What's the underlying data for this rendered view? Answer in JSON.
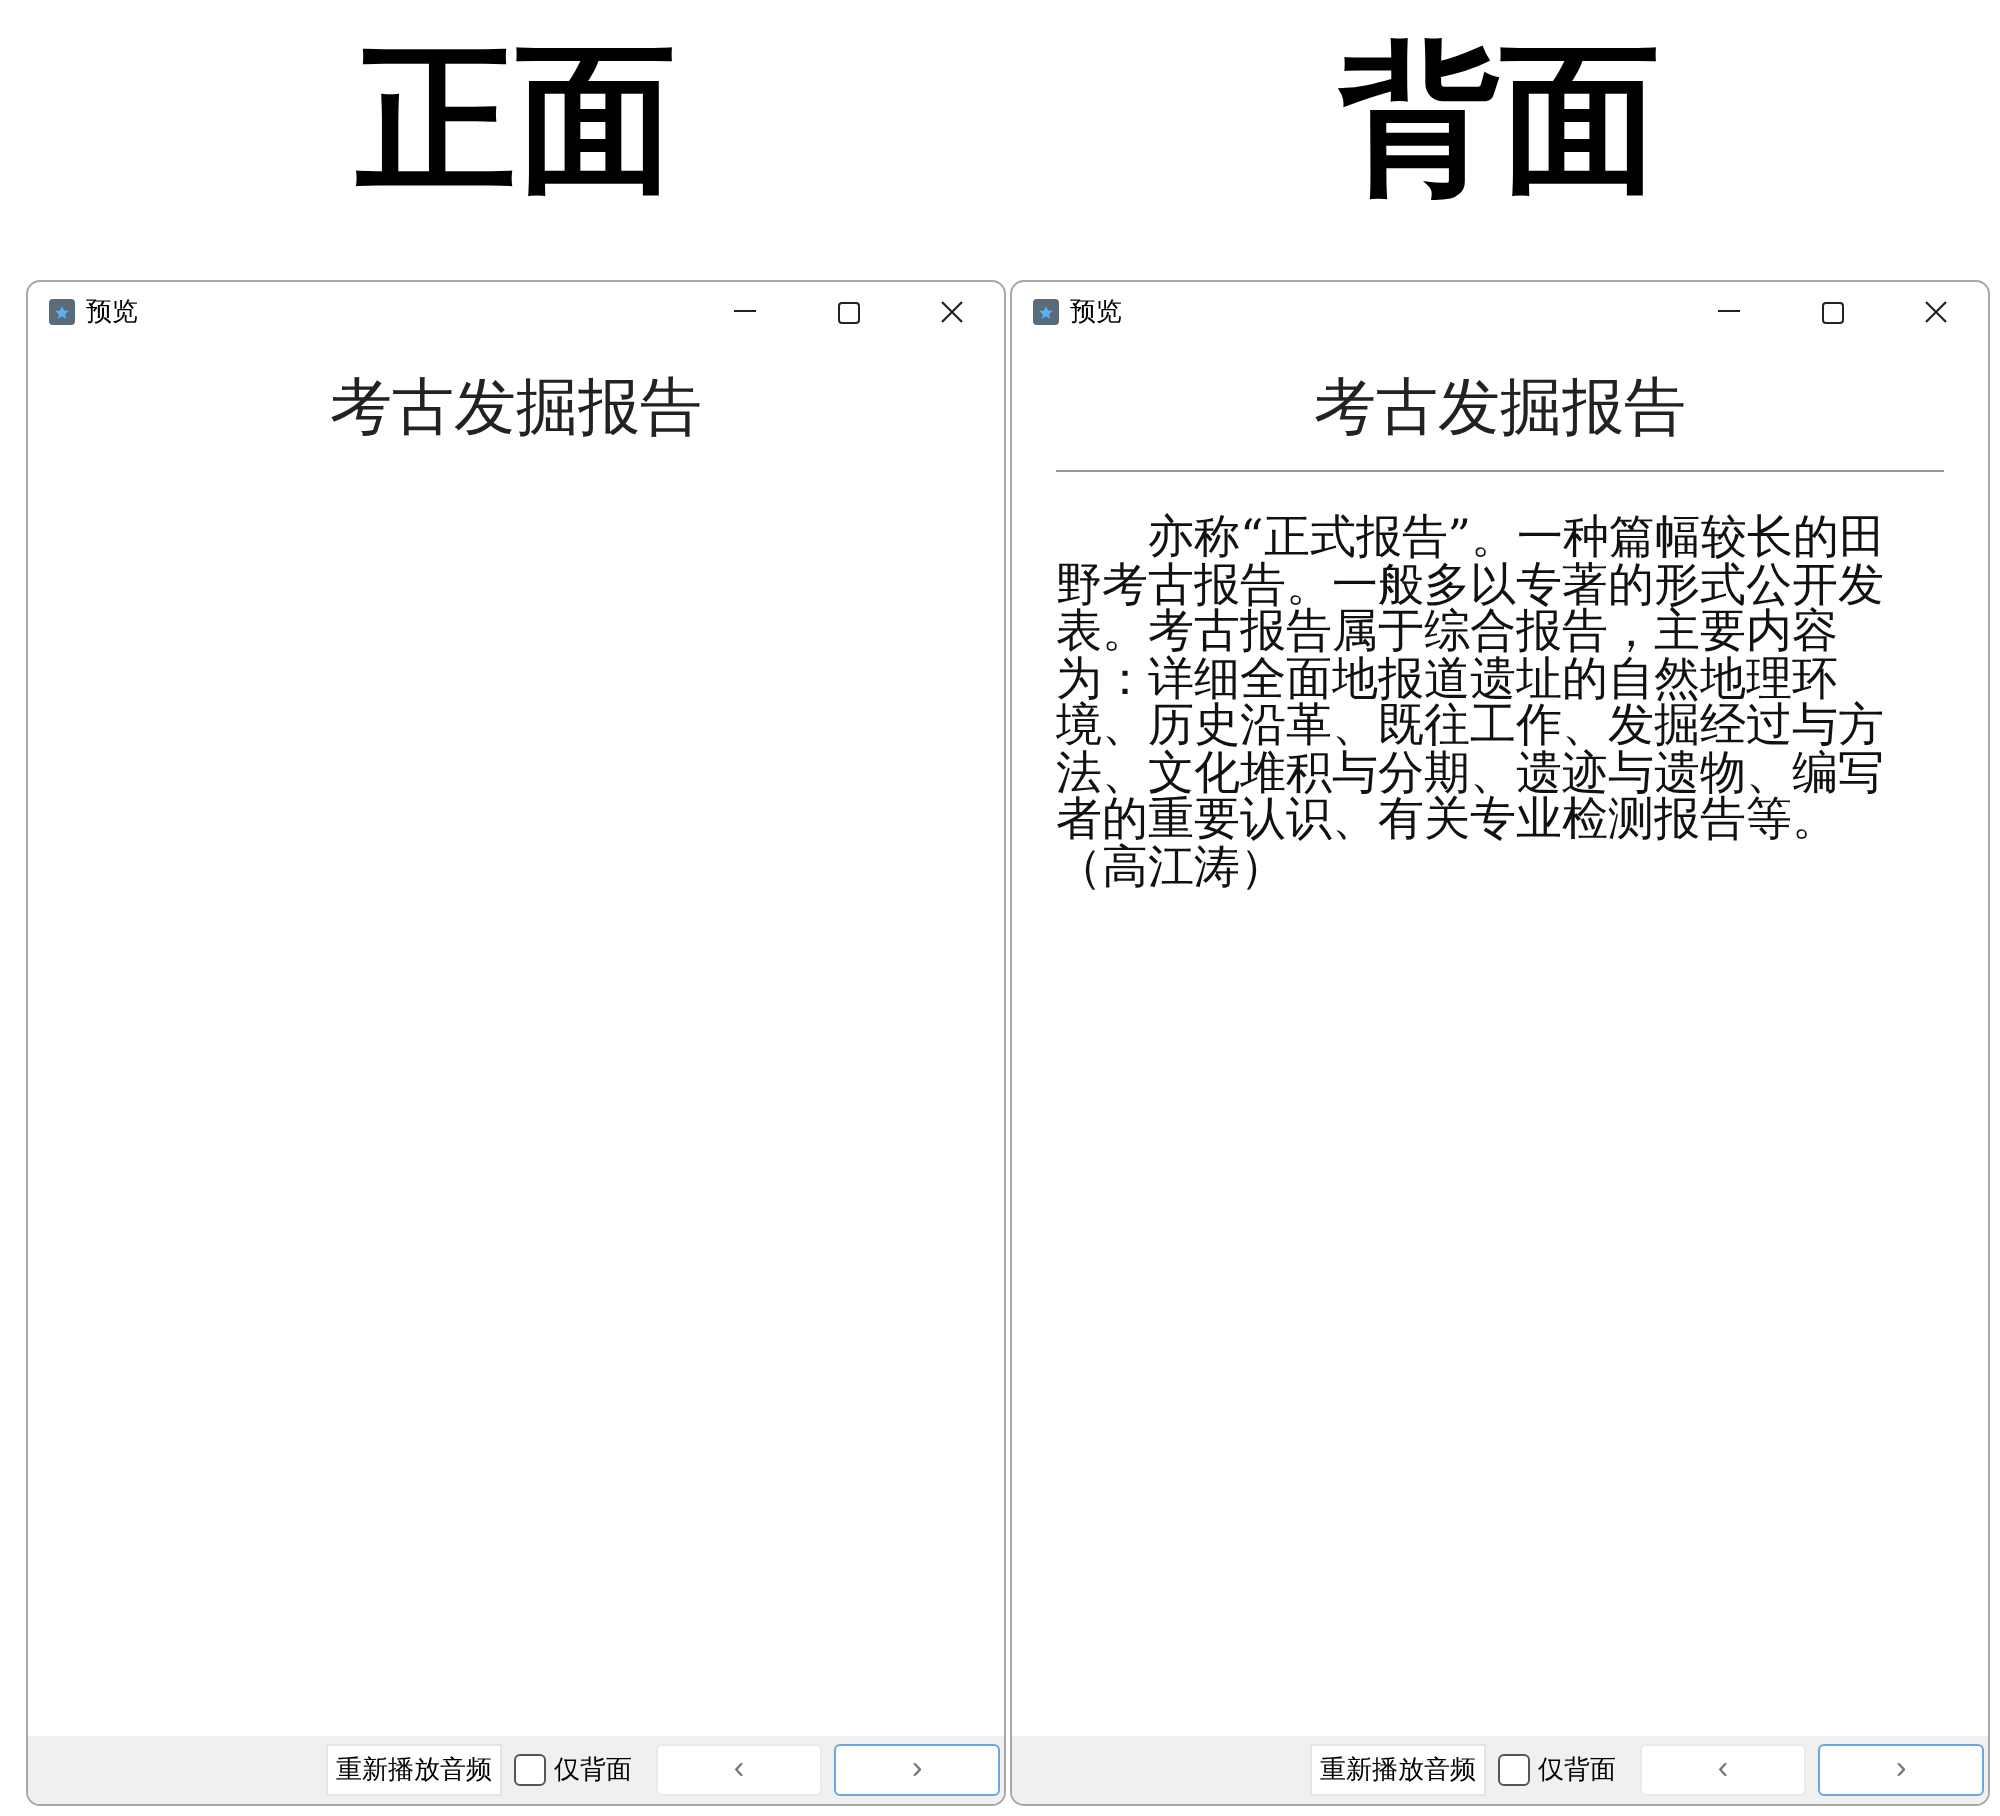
{
  "panels": [
    {
      "label": "正面",
      "window": {
        "title": "预览",
        "heading": "考古发掘报告",
        "footer": {
          "replay_button": "重新播放音频",
          "checkbox": {
            "label": "仅背面",
            "checked": false
          },
          "prev_button": {
            "label": "‹",
            "focused": false
          },
          "next_button": {
            "label": "›",
            "focused": true
          }
        }
      }
    },
    {
      "label": "背面",
      "window": {
        "title": "预览",
        "heading": "考古发掘报告",
        "body": "亦称“正式报告”。一种篇幅较长的田野考古报告。一般多以专著的形式公开发表。考古报告属于综合报告，主要内容为：详细全面地报道遗址的自然地理环境、历史沿革、既往工作、发掘经过与方法、文化堆积与分期、遗迹与遗物、编写者的重要认识、有关专业检测报告等。（高江涛）",
        "footer": {
          "replay_button": "重新播放音频",
          "checkbox": {
            "label": "仅背面",
            "checked": false
          },
          "prev_button": {
            "label": "‹",
            "focused": false
          },
          "next_button": {
            "label": "›",
            "focused": true
          }
        }
      }
    }
  ]
}
